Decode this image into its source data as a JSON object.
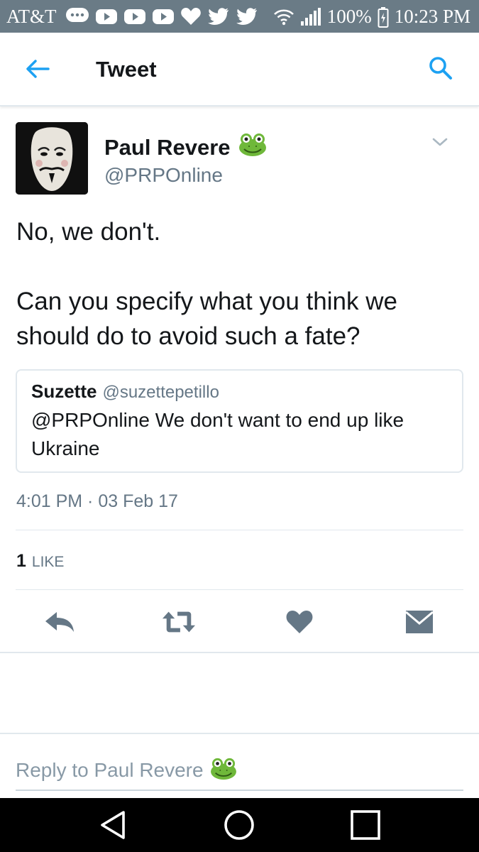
{
  "status_bar": {
    "carrier": "AT&T",
    "battery": "100%",
    "time": "10:23 PM",
    "icons": [
      "chat-icon",
      "youtube-icon",
      "youtube-icon",
      "youtube-icon",
      "heart-icon",
      "twitter-icon",
      "twitter-icon",
      "wifi-icon",
      "signal-icon",
      "battery-icon"
    ]
  },
  "header": {
    "title": "Tweet",
    "back_icon": "back-arrow-icon",
    "search_icon": "search-icon"
  },
  "tweet": {
    "author_name": "Paul Revere",
    "author_emoji": "🐸",
    "author_handle": "@PRPOnline",
    "text": "No, we don't.\n\nCan you specify what you think we should do to avoid such a fate?",
    "timestamp": "4:01 PM · 03 Feb 17",
    "likes_count": "1",
    "likes_label": "LIKE"
  },
  "quoted_tweet": {
    "author_name": "Suzette",
    "author_handle": "@suzettepetillo",
    "text": "@PRPOnline We don't want to end up like Ukraine"
  },
  "actions": [
    "reply-icon",
    "retweet-icon",
    "like-icon",
    "direct-message-icon"
  ],
  "reply_box": {
    "placeholder": "Reply to Paul Revere",
    "emoji": "🐸"
  },
  "colors": {
    "status_bar": "#6a7b86",
    "accent": "#1da1f2",
    "action_icon": "#657786",
    "secondary_text": "#657786"
  }
}
